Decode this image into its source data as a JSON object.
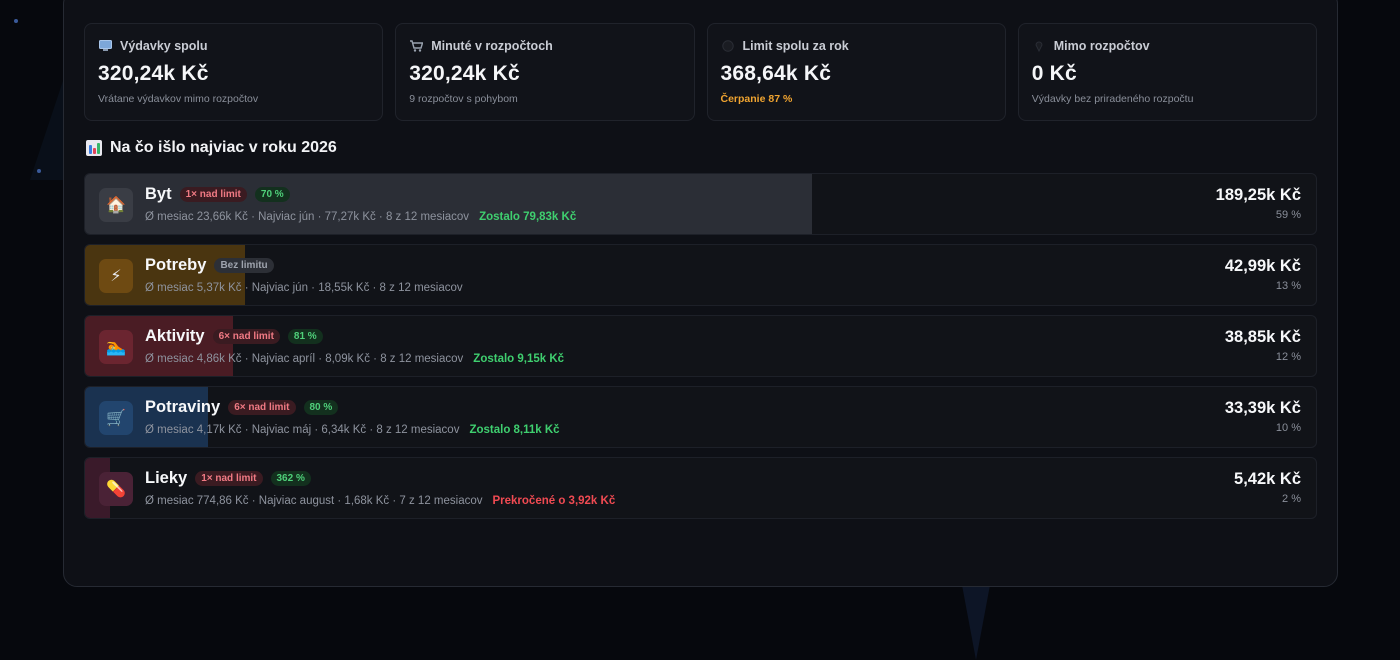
{
  "stats": [
    {
      "icon": "monitor-icon",
      "label": "Výdavky spolu",
      "value": "320,24k Kč",
      "sub": "Vrátane výdavkov mimo rozpočtov",
      "sub_style": "normal"
    },
    {
      "icon": "cart-icon",
      "label": "Minuté v rozpočtoch",
      "value": "320,24k Kč",
      "sub": "9 rozpočtov s pohybom",
      "sub_style": "normal"
    },
    {
      "icon": "target-icon",
      "label": "Limit spolu za rok",
      "value": "368,64k Kč",
      "sub": "Čerpanie 87 %",
      "sub_style": "warn"
    },
    {
      "icon": "pin-icon",
      "label": "Mimo rozpočtov",
      "value": "0 Kč",
      "sub": "Výdavky bez priradeného rozpočtu",
      "sub_style": "normal"
    }
  ],
  "section": {
    "title": "Na čo išlo najviac v roku 2026",
    "icon": "bar-chart-icon"
  },
  "categories": [
    {
      "name": "Byt",
      "icon": "house-icon",
      "icon_glyph": "🏠",
      "icon_bg": "#3a3d45",
      "badges": [
        {
          "text": "1× nad limit",
          "style": "red"
        },
        {
          "text": "70 %",
          "style": "green"
        }
      ],
      "meta": "Ø mesiac 23,66k Kč · Najviac jún · 77,27k Kč · 8 z 12 mesiacov",
      "note": "Zostalo 79,83k Kč",
      "note_style": "ok",
      "amount": "189,25k Kč",
      "percent": "59 %",
      "share": 0.59,
      "fill_color": "#2b2e36"
    },
    {
      "name": "Potreby",
      "icon": "lightning-icon",
      "icon_glyph": "⚡",
      "icon_bg": "#6e4a12",
      "badges": [
        {
          "text": "Bez limitu",
          "style": "gray"
        }
      ],
      "meta": "Ø mesiac 5,37k Kč · Najviac jún · 18,55k Kč · 8 z 12 mesiacov",
      "note": "",
      "note_style": "",
      "amount": "42,99k Kč",
      "percent": "13 %",
      "share": 0.13,
      "fill_color": "#4a3510"
    },
    {
      "name": "Aktivity",
      "icon": "activity-icon",
      "icon_glyph": "🏊",
      "icon_bg": "#6b2530",
      "badges": [
        {
          "text": "6× nad limit",
          "style": "red"
        },
        {
          "text": "81 %",
          "style": "green"
        }
      ],
      "meta": "Ø mesiac 4,86k Kč · Najviac apríl · 8,09k Kč · 8 z 12 mesiacov",
      "note": "Zostalo 9,15k Kč",
      "note_style": "ok",
      "amount": "38,85k Kč",
      "percent": "12 %",
      "share": 0.12,
      "fill_color": "#4a1c24"
    },
    {
      "name": "Potraviny",
      "icon": "cart-icon",
      "icon_glyph": "🛒",
      "icon_bg": "#22456e",
      "badges": [
        {
          "text": "6× nad limit",
          "style": "red"
        },
        {
          "text": "80 %",
          "style": "green"
        }
      ],
      "meta": "Ø mesiac 4,17k Kč · Najviac máj · 6,34k Kč · 8 z 12 mesiacov",
      "note": "Zostalo 8,11k Kč",
      "note_style": "ok",
      "amount": "33,39k Kč",
      "percent": "10 %",
      "share": 0.1,
      "fill_color": "#1a3250"
    },
    {
      "name": "Lieky",
      "icon": "pill-icon",
      "icon_glyph": "💊",
      "icon_bg": "#4a2236",
      "badges": [
        {
          "text": "1× nad limit",
          "style": "red"
        },
        {
          "text": "362 %",
          "style": "green"
        }
      ],
      "meta": "Ø mesiac 774,86 Kč · Najviac august · 1,68k Kč · 7 z 12 mesiacov",
      "note": "Prekročené o 3,92k Kč",
      "note_style": "bad",
      "amount": "5,42k Kč",
      "percent": "2 %",
      "share": 0.02,
      "fill_color": "#3a1a2a"
    }
  ]
}
